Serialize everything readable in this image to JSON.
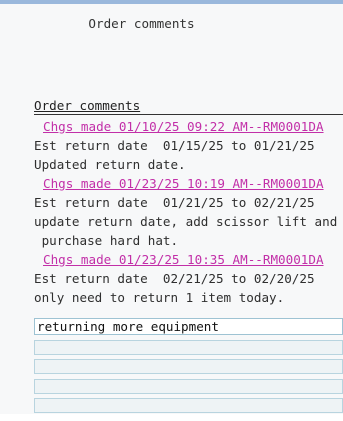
{
  "window": {
    "title": "Order comments"
  },
  "section": {
    "header": "Order comments"
  },
  "comments": [
    {
      "type": "link",
      "text": "Chgs made 01/10/25 09:22 AM--RM0001DA"
    },
    {
      "type": "text",
      "text": "Est return date  01/15/25 to 01/21/25"
    },
    {
      "type": "text",
      "text": "Updated return date."
    },
    {
      "type": "link",
      "text": "Chgs made 01/23/25 10:19 AM--RM0001DA"
    },
    {
      "type": "text",
      "text": "Est return date  01/21/25 to 02/21/25"
    },
    {
      "type": "text",
      "text": "update return date, add scissor lift and"
    },
    {
      "type": "text",
      "text": " purchase hard hat."
    },
    {
      "type": "link",
      "text": "Chgs made 01/23/25 10:35 AM--RM0001DA"
    },
    {
      "type": "text",
      "text": "Est return date  02/21/25 to 02/20/25"
    },
    {
      "type": "text",
      "text": "only need to return 1 item today."
    }
  ],
  "input_fields": [
    {
      "value": "returning more equipment"
    },
    {
      "value": ""
    },
    {
      "value": ""
    },
    {
      "value": ""
    },
    {
      "value": ""
    }
  ]
}
